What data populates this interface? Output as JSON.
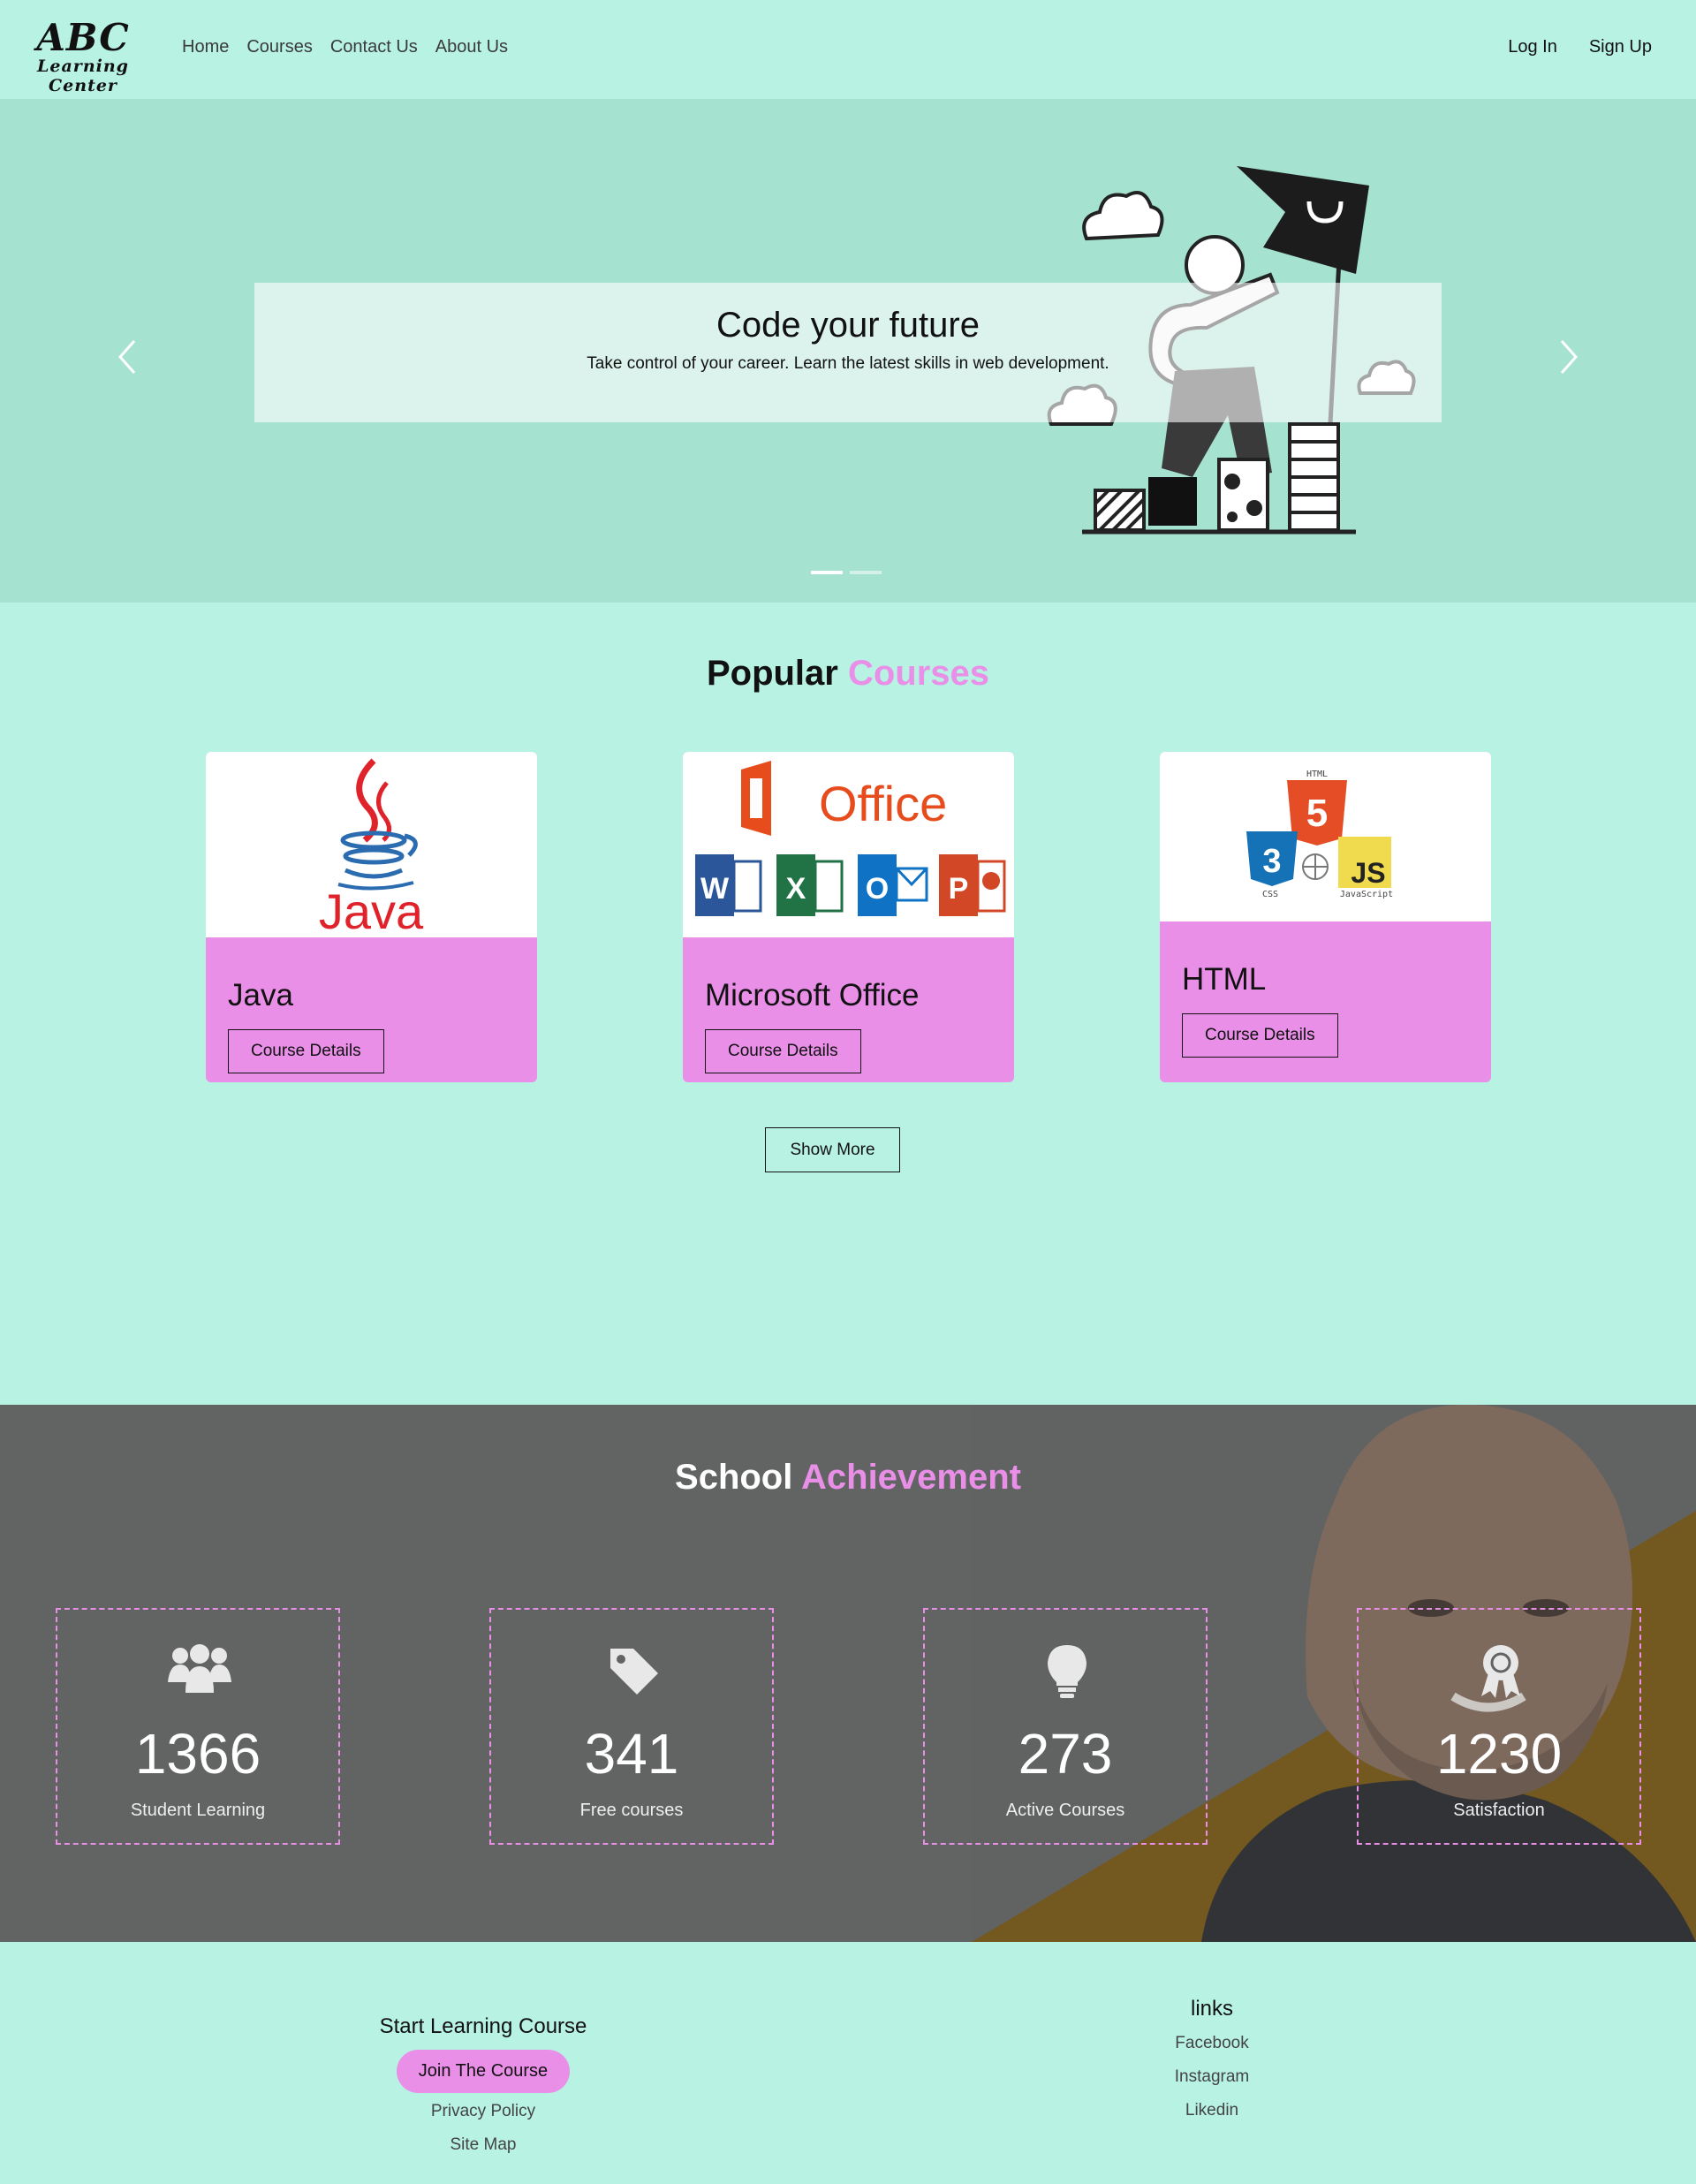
{
  "brand": {
    "line1": "ABC",
    "line2": "Learning Center"
  },
  "nav": {
    "links": [
      "Home",
      "Courses",
      "Contact Us",
      "About Us"
    ],
    "login": "Log In",
    "signup": "Sign Up"
  },
  "hero": {
    "title": "Code your future",
    "subtitle": "Take control of your career. Learn the latest skills in web development.",
    "slides_total": 2,
    "active_slide": 1
  },
  "courses": {
    "title_plain": "Popular",
    "title_accent": "Courses",
    "items": [
      {
        "name": "Java",
        "button": "Course Details",
        "logo_text": "Java"
      },
      {
        "name": "Microsoft Office",
        "button": "Course Details",
        "logo_text": "Office",
        "app_letters": [
          "W",
          "X",
          "O",
          "P"
        ]
      },
      {
        "name": "HTML",
        "button": "Course Details",
        "logo_labels": [
          "HTML",
          "5",
          "3",
          "JS",
          "CSS",
          "JavaScript"
        ]
      }
    ],
    "show_more": "Show More"
  },
  "achievement": {
    "title_plain": "School",
    "title_accent": "Achievement",
    "stats": [
      {
        "value": "1366",
        "label": "Student Learning",
        "icon": "users-icon"
      },
      {
        "value": "341",
        "label": "Free courses",
        "icon": "tag-icon"
      },
      {
        "value": "273",
        "label": "Active Courses",
        "icon": "lightbulb-icon"
      },
      {
        "value": "1230",
        "label": "Satisfaction",
        "icon": "award-icon"
      }
    ]
  },
  "footer": {
    "col1": {
      "heading": "Start Learning Course",
      "button": "Join The Course",
      "links": [
        "Privacy Policy",
        "Site Map"
      ]
    },
    "col2": {
      "heading": "links",
      "links": [
        "Facebook",
        "Instagram",
        "Likedin"
      ]
    }
  },
  "colors": {
    "mint": "#b7f2e3",
    "hero_bg": "#a6e2d0",
    "accent_pink": "#e98fe8",
    "achievement_bg": "#626363"
  }
}
